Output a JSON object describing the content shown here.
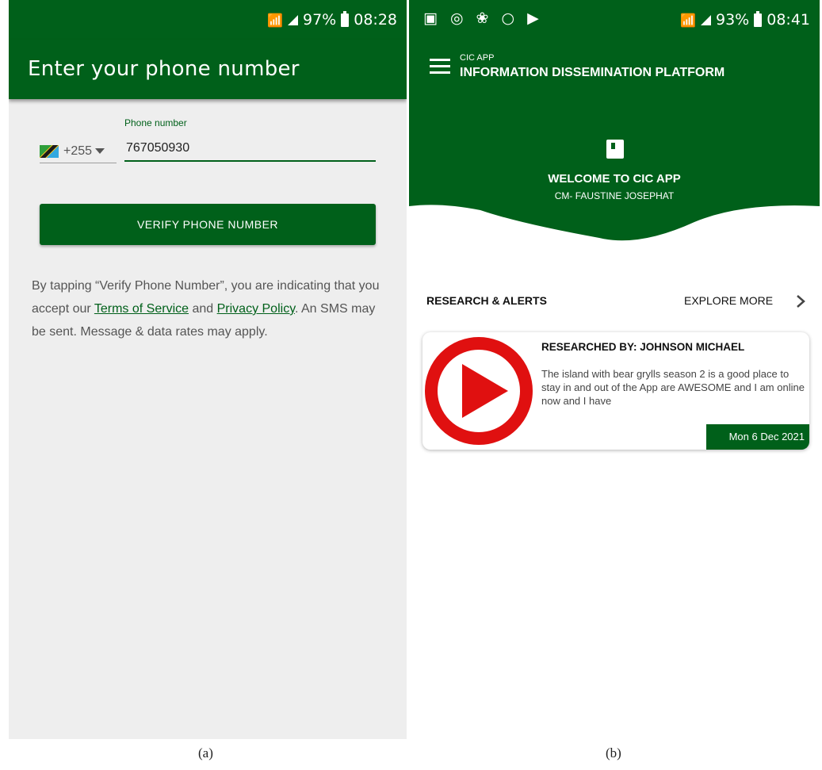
{
  "screen_a": {
    "status": {
      "battery": "97%",
      "time": "08:28"
    },
    "title": "Enter your phone number",
    "phone_label": "Phone number",
    "country_code": "+255",
    "phone_value": "767050930",
    "verify_label": "VERIFY PHONE NUMBER",
    "terms": {
      "pre": "By tapping “Verify Phone Number”, you are indicating that you accept our ",
      "tos": "Terms of Service",
      "and": " and ",
      "privacy": "Privacy Policy",
      "post": ". An SMS may be sent. Message & data rates may apply."
    }
  },
  "screen_b": {
    "status": {
      "battery": "93%",
      "time": "08:41"
    },
    "app_small": "CIC APP",
    "app_big": "INFORMATION DISSEMINATION PLATFORM",
    "welcome": "WELCOME TO CIC APP",
    "user": "CM- FAUSTINE JOSEPHAT",
    "section_title": "RESEARCH & ALERTS",
    "explore_label": "EXPLORE MORE",
    "card": {
      "researched_by": "RESEARCHED BY: JOHNSON MICHAEL",
      "description": "The island with bear grylls season 2 is a good place to stay in and out of the App are AWESOME and I am online now and I have",
      "date": "Mon 6 Dec 2021"
    }
  },
  "captions": {
    "a": "(a)",
    "b": "(b)"
  },
  "colors": {
    "primary": "#00601a",
    "background_a": "#eeeeee",
    "play_red": "#e01010"
  }
}
